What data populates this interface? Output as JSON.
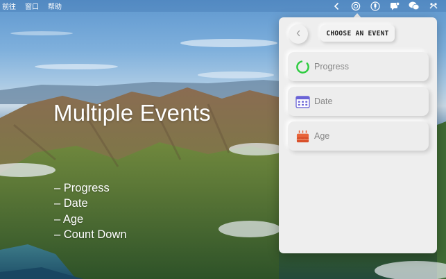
{
  "menubar": {
    "items": [
      "前往",
      "窗口",
      "帮助"
    ],
    "status_icons": [
      "chevron-left-icon",
      "event-app-icon",
      "microphone-icon",
      "notification-icon",
      "wechat-icon",
      "control-center-icon"
    ]
  },
  "hero": {
    "title": "Multiple Events",
    "features": [
      "Progress",
      "Date",
      "Age",
      "Count Down"
    ]
  },
  "panel": {
    "title": "CHOOSE AN EVENT",
    "events": [
      {
        "label": "Progress",
        "icon": "progress-ring-icon",
        "color": "#2ecc40"
      },
      {
        "label": "Date",
        "icon": "calendar-icon",
        "color": "#6a63d6"
      },
      {
        "label": "Age",
        "icon": "birthday-cake-icon",
        "color": "#e8653a"
      }
    ]
  },
  "colors": {
    "panel_bg": "#eeeeee",
    "card_bg": "#ededed",
    "label_text": "#888888"
  }
}
